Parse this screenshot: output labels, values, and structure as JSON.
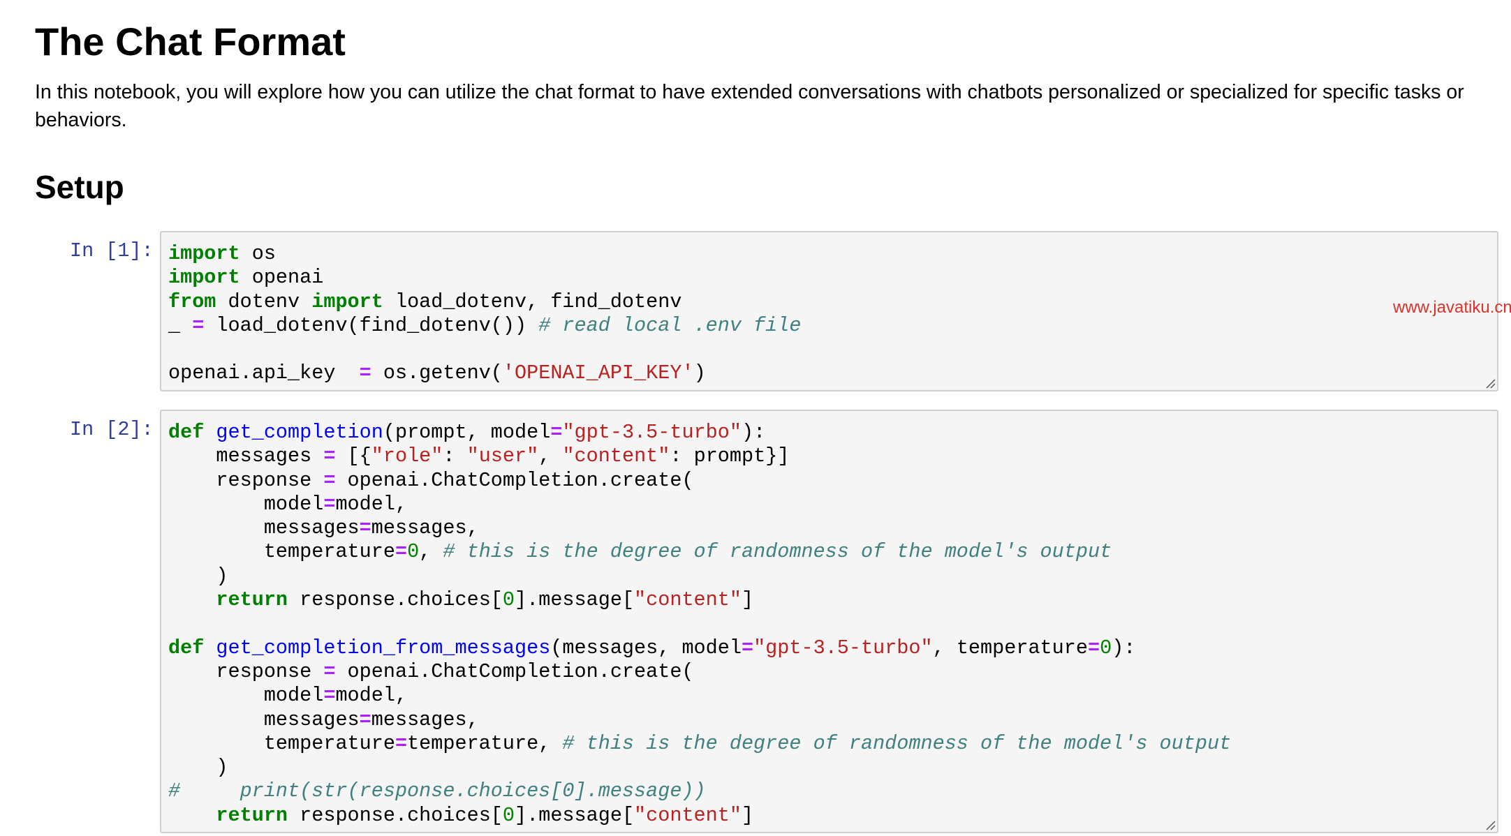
{
  "page_title": "The Chat Format",
  "intro_text": "In this notebook, you will explore how you can utilize the chat format to have extended conversations with chatbots personalized or specialized for specific tasks or behaviors.",
  "section_heading": "Setup",
  "watermark": "www.javatiku.cn",
  "cells": [
    {
      "prompt": "In [1]:",
      "code": [
        [
          {
            "t": "import",
            "c": "kw"
          },
          {
            "t": " os",
            "c": ""
          }
        ],
        [
          {
            "t": "import",
            "c": "kw"
          },
          {
            "t": " openai",
            "c": ""
          }
        ],
        [
          {
            "t": "from",
            "c": "kw"
          },
          {
            "t": " dotenv ",
            "c": ""
          },
          {
            "t": "import",
            "c": "kw"
          },
          {
            "t": " load_dotenv, find_dotenv",
            "c": ""
          }
        ],
        [
          {
            "t": "_ ",
            "c": ""
          },
          {
            "t": "=",
            "c": "op"
          },
          {
            "t": " load_dotenv(find_dotenv()) ",
            "c": ""
          },
          {
            "t": "# read local .env file",
            "c": "cm"
          }
        ],
        [],
        [
          {
            "t": "openai.api_key  ",
            "c": ""
          },
          {
            "t": "=",
            "c": "op"
          },
          {
            "t": " os.getenv(",
            "c": ""
          },
          {
            "t": "'OPENAI_API_KEY'",
            "c": "str"
          },
          {
            "t": ")",
            "c": ""
          }
        ]
      ]
    },
    {
      "prompt": "In [2]:",
      "code": [
        [
          {
            "t": "def",
            "c": "kw"
          },
          {
            "t": " ",
            "c": ""
          },
          {
            "t": "get_completion",
            "c": "fn"
          },
          {
            "t": "(prompt, model",
            "c": ""
          },
          {
            "t": "=",
            "c": "op"
          },
          {
            "t": "\"gpt-3.5-turbo\"",
            "c": "str"
          },
          {
            "t": "):",
            "c": ""
          }
        ],
        [
          {
            "t": "    messages ",
            "c": ""
          },
          {
            "t": "=",
            "c": "op"
          },
          {
            "t": " [{",
            "c": ""
          },
          {
            "t": "\"role\"",
            "c": "str"
          },
          {
            "t": ": ",
            "c": ""
          },
          {
            "t": "\"user\"",
            "c": "str"
          },
          {
            "t": ", ",
            "c": ""
          },
          {
            "t": "\"content\"",
            "c": "str"
          },
          {
            "t": ": prompt}]",
            "c": ""
          }
        ],
        [
          {
            "t": "    response ",
            "c": ""
          },
          {
            "t": "=",
            "c": "op"
          },
          {
            "t": " openai.ChatCompletion.create(",
            "c": ""
          }
        ],
        [
          {
            "t": "        model",
            "c": ""
          },
          {
            "t": "=",
            "c": "op"
          },
          {
            "t": "model,",
            "c": ""
          }
        ],
        [
          {
            "t": "        messages",
            "c": ""
          },
          {
            "t": "=",
            "c": "op"
          },
          {
            "t": "messages,",
            "c": ""
          }
        ],
        [
          {
            "t": "        temperature",
            "c": ""
          },
          {
            "t": "=",
            "c": "op"
          },
          {
            "t": "0",
            "c": "num"
          },
          {
            "t": ", ",
            "c": ""
          },
          {
            "t": "# this is the degree of randomness of the model's output",
            "c": "cm"
          }
        ],
        [
          {
            "t": "    )",
            "c": ""
          }
        ],
        [
          {
            "t": "    ",
            "c": ""
          },
          {
            "t": "return",
            "c": "kw"
          },
          {
            "t": " response.choices[",
            "c": ""
          },
          {
            "t": "0",
            "c": "num"
          },
          {
            "t": "].message[",
            "c": ""
          },
          {
            "t": "\"content\"",
            "c": "str"
          },
          {
            "t": "]",
            "c": ""
          }
        ],
        [],
        [
          {
            "t": "def",
            "c": "kw"
          },
          {
            "t": " ",
            "c": ""
          },
          {
            "t": "get_completion_from_messages",
            "c": "fn"
          },
          {
            "t": "(messages, model",
            "c": ""
          },
          {
            "t": "=",
            "c": "op"
          },
          {
            "t": "\"gpt-3.5-turbo\"",
            "c": "str"
          },
          {
            "t": ", temperature",
            "c": ""
          },
          {
            "t": "=",
            "c": "op"
          },
          {
            "t": "0",
            "c": "num"
          },
          {
            "t": "):",
            "c": ""
          }
        ],
        [
          {
            "t": "    response ",
            "c": ""
          },
          {
            "t": "=",
            "c": "op"
          },
          {
            "t": " openai.ChatCompletion.create(",
            "c": ""
          }
        ],
        [
          {
            "t": "        model",
            "c": ""
          },
          {
            "t": "=",
            "c": "op"
          },
          {
            "t": "model,",
            "c": ""
          }
        ],
        [
          {
            "t": "        messages",
            "c": ""
          },
          {
            "t": "=",
            "c": "op"
          },
          {
            "t": "messages,",
            "c": ""
          }
        ],
        [
          {
            "t": "        temperature",
            "c": ""
          },
          {
            "t": "=",
            "c": "op"
          },
          {
            "t": "temperature, ",
            "c": ""
          },
          {
            "t": "# this is the degree of randomness of the model's output",
            "c": "cm"
          }
        ],
        [
          {
            "t": "    )",
            "c": ""
          }
        ],
        [
          {
            "t": "#     print(str(response.choices[0].message))",
            "c": "cm"
          }
        ],
        [
          {
            "t": "    ",
            "c": ""
          },
          {
            "t": "return",
            "c": "kw"
          },
          {
            "t": " response.choices[",
            "c": ""
          },
          {
            "t": "0",
            "c": "num"
          },
          {
            "t": "].message[",
            "c": ""
          },
          {
            "t": "\"content\"",
            "c": "str"
          },
          {
            "t": "]",
            "c": ""
          }
        ]
      ]
    }
  ],
  "colors": {
    "keyword": "#008000",
    "function_name": "#0000ff",
    "string": "#ba2121",
    "number": "#008000",
    "operator": "#aa22ff",
    "comment": "#408080",
    "prompt": "#303f9f",
    "cell_background": "#f5f5f5",
    "cell_border": "#cfcfcf",
    "watermark": "#d9342b"
  },
  "icons": {
    "resize_grip": "resize-grip-icon"
  }
}
